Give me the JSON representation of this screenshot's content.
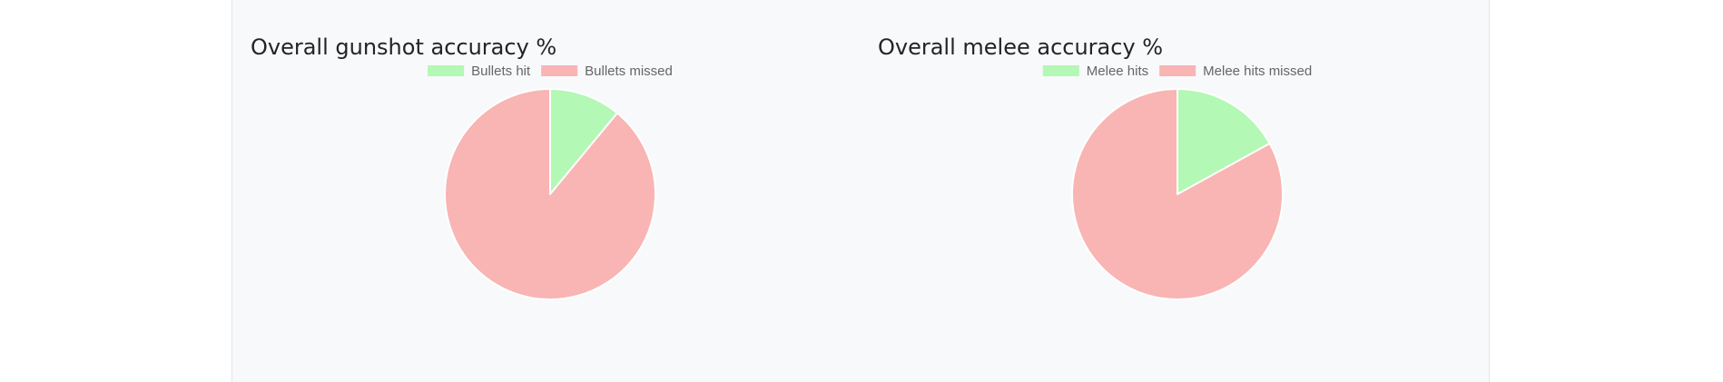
{
  "charts_section": {
    "gunshot": {
      "title": "Overall gunshot accuracy %"
    },
    "melee": {
      "title": "Overall melee accuracy %"
    }
  },
  "colors": {
    "hit": "#b3f8b5",
    "missed": "#f9b4b4",
    "slice_border": "#ffffff",
    "legend_text": "#666666"
  },
  "chart_data": [
    {
      "type": "pie",
      "title": "Overall gunshot accuracy %",
      "categories": [
        "Bullets hit",
        "Bullets missed"
      ],
      "values": [
        11,
        89
      ],
      "legend": "top"
    },
    {
      "type": "pie",
      "title": "Overall melee accuracy %",
      "categories": [
        "Melee hits",
        "Melee hits missed"
      ],
      "values": [
        17,
        83
      ],
      "legend": "top"
    }
  ]
}
